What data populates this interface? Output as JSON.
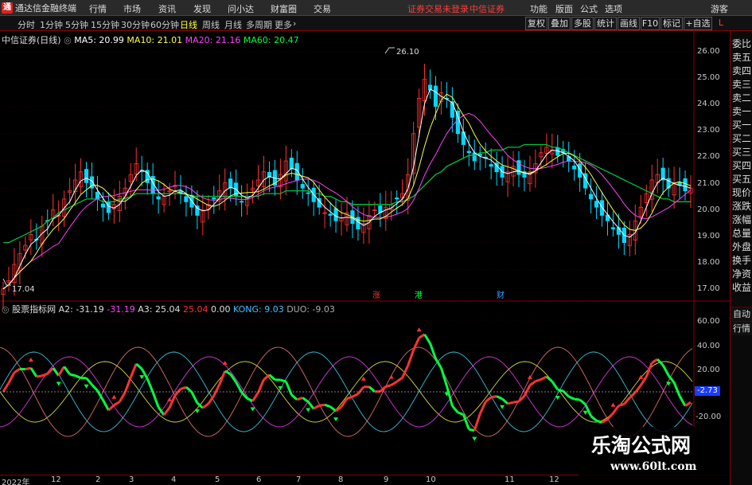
{
  "app": {
    "title": "通达信金融终端",
    "logo_glyph": "通"
  },
  "menu": [
    "行情",
    "市场",
    "资讯",
    "发现",
    "问小达",
    "财富圈",
    "交易"
  ],
  "status": {
    "login": "证券交易未登录",
    "broker": "中信证券"
  },
  "top_right": [
    "功能",
    "版面",
    "公式",
    "选项",
    "游客"
  ],
  "periods": [
    "分时",
    "1分钟",
    "5分钟",
    "15分钟",
    "30分钟",
    "60分钟",
    "日线",
    "周线",
    "月线",
    "多周期",
    "更多"
  ],
  "active_period": "日线",
  "toolbar": [
    "复权",
    "叠加",
    "多股",
    "统计",
    "画线",
    "F10",
    "标记",
    "+自选"
  ],
  "price_legend": {
    "name": "中信证券(日线)",
    "ma5": "MA5: 20.99",
    "ma10": "MA10: 21.01",
    "ma20": "MA20: 21.16",
    "ma60": "MA60: 20.47"
  },
  "indicator_legend": {
    "name": "股票指标网",
    "a2": "A2: -31.19",
    "a2b": "-31.19",
    "a3": "A3: 25.04",
    "v": "25.04",
    "z": "0.00",
    "kong": "KONG: 9.03",
    "duo": "DUO: -9.03"
  },
  "price_axis": [
    "26.00",
    "25.00",
    "24.00",
    "23.00",
    "22.00",
    "21.00",
    "20.00",
    "19.00",
    "18.00",
    "17.00"
  ],
  "ind_axis": [
    "60.00",
    "40.00",
    "20.00",
    "-20.00"
  ],
  "price_annotations": {
    "high": "26.10",
    "low": "17.04"
  },
  "event_markers": [
    "涨",
    "港",
    "财"
  ],
  "current_value_badge": "-2.73",
  "right_panel": [
    "委比",
    "卖五",
    "卖四",
    "卖三",
    "卖二",
    "卖一",
    "买一",
    "买二",
    "买三",
    "买四",
    "买五",
    "现价",
    "涨跌",
    "涨幅",
    "总量",
    "外盘",
    "换手",
    "净资",
    "收益"
  ],
  "right_panel_buttons": [
    "自动",
    "行情"
  ],
  "date_axis": [
    "2022年",
    "12",
    "2",
    "3",
    "4",
    "5",
    "6",
    "7",
    "8",
    "9",
    "10",
    "11",
    "12"
  ],
  "watermark": {
    "title": "乐淘公式网",
    "url": "www.60lt.com"
  },
  "colors": {
    "up": "#ff3232",
    "down": "#00ff40",
    "ma5": "#ffffff",
    "ma10": "#ffff00",
    "ma20": "#ff40ff",
    "ma60": "#00ff40"
  },
  "chart_data": {
    "type": "candlestick",
    "price_range": [
      17.0,
      26.3
    ],
    "price_close_series": [
      17.3,
      17.6,
      18.2,
      18.6,
      18.9,
      19.3,
      19.1,
      19.6,
      19.8,
      20.2,
      20.0,
      20.6,
      20.9,
      21.3,
      21.6,
      21.2,
      21.0,
      20.6,
      20.3,
      20.1,
      20.4,
      20.7,
      21.0,
      21.5,
      21.9,
      21.6,
      21.2,
      20.8,
      20.6,
      20.7,
      20.9,
      21.1,
      20.8,
      20.5,
      20.3,
      20.0,
      20.2,
      20.4,
      20.6,
      20.9,
      21.2,
      21.0,
      20.7,
      20.5,
      20.7,
      21.0,
      21.3,
      21.6,
      21.4,
      21.1,
      21.5,
      22.0,
      21.7,
      21.3,
      21.0,
      20.8,
      20.5,
      20.3,
      20.1,
      20.0,
      19.8,
      19.9,
      20.1,
      19.7,
      19.5,
      19.7,
      20.0,
      20.2,
      20.1,
      20.3,
      20.4,
      20.6,
      20.8,
      21.5,
      23.0,
      24.3,
      25.0,
      24.6,
      24.0,
      24.5,
      24.3,
      23.6,
      23.0,
      22.6,
      22.3,
      22.0,
      22.2,
      22.1,
      21.8,
      21.6,
      21.4,
      21.6,
      21.8,
      21.5,
      21.4,
      21.6,
      21.9,
      22.3,
      22.5,
      22.4,
      22.2,
      22.3,
      22.0,
      21.7,
      21.4,
      21.0,
      20.6,
      20.3,
      20.0,
      19.8,
      19.5,
      19.3,
      19.0,
      19.3,
      19.8,
      20.3,
      20.8,
      21.3,
      21.5,
      21.3,
      21.0,
      21.2,
      21.1,
      20.9,
      21.0
    ],
    "ma60_series": [
      19.0,
      19.0,
      19.1,
      19.2,
      19.3,
      19.4,
      19.5,
      19.6,
      19.8,
      19.9,
      20.1,
      20.2,
      20.3,
      20.4,
      20.5,
      20.6,
      20.6,
      20.6,
      20.5,
      20.5,
      20.5,
      20.6,
      20.6,
      20.7,
      20.8,
      20.8,
      20.8,
      20.8,
      20.8,
      20.8,
      20.8,
      20.8,
      20.8,
      20.8,
      20.7,
      20.7,
      20.7,
      20.7,
      20.7,
      20.7,
      20.7,
      20.7,
      20.7,
      20.7,
      20.7,
      20.7,
      20.7,
      20.8,
      20.8,
      20.8,
      20.8,
      20.9,
      20.9,
      20.9,
      20.9,
      20.9,
      20.8,
      20.8,
      20.7,
      20.7,
      20.6,
      20.5,
      20.5,
      20.4,
      20.4,
      20.4,
      20.4,
      20.4,
      20.4,
      20.4,
      20.4,
      20.5,
      20.5,
      20.6,
      20.7,
      20.9,
      21.1,
      21.3,
      21.5,
      21.6,
      21.8,
      21.9,
      22.0,
      22.1,
      22.2,
      22.2,
      22.3,
      22.3,
      22.4,
      22.4,
      22.4,
      22.5,
      22.5,
      22.5,
      22.6,
      22.6,
      22.6,
      22.6,
      22.6,
      22.5,
      22.5,
      22.4,
      22.3,
      22.2,
      22.1,
      22.0,
      21.9,
      21.8,
      21.7,
      21.6,
      21.5,
      21.4,
      21.3,
      21.2,
      21.1,
      21.0,
      20.9,
      20.8,
      20.7,
      20.6,
      20.6,
      20.5,
      20.5,
      20.5,
      20.5
    ]
  }
}
